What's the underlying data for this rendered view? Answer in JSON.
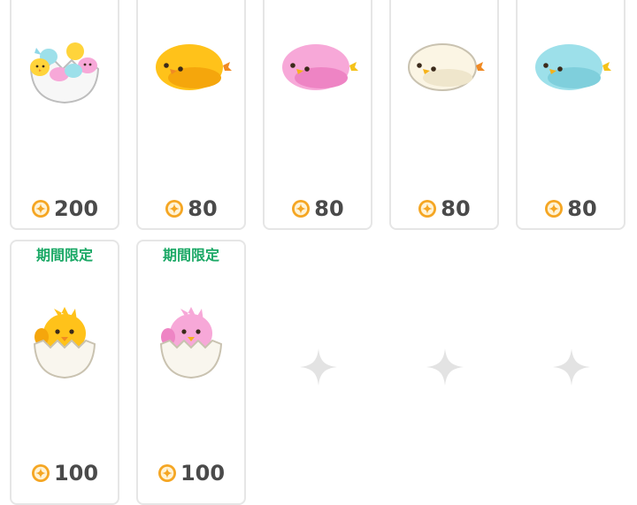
{
  "items": [
    {
      "id": "chick-egg-set",
      "price": "200"
    },
    {
      "id": "yellow-chick",
      "price": "80"
    },
    {
      "id": "pink-chick",
      "price": "80"
    },
    {
      "id": "white-chick",
      "price": "80"
    },
    {
      "id": "blue-chick",
      "price": "80"
    },
    {
      "id": "yellow-chick-egg",
      "price": "100",
      "badge": "期間限定"
    },
    {
      "id": "pink-chick-egg",
      "price": "100",
      "badge": "期間限定"
    }
  ],
  "colors": {
    "coin": "#f5a623",
    "limited_badge": "#1aa865",
    "price_text": "#4a4a4a",
    "card_border": "#e6e6e6",
    "placeholder": "#e3e3e3"
  },
  "icons": {
    "coin": "coin-icon",
    "placeholder": "sparkle-icon"
  }
}
